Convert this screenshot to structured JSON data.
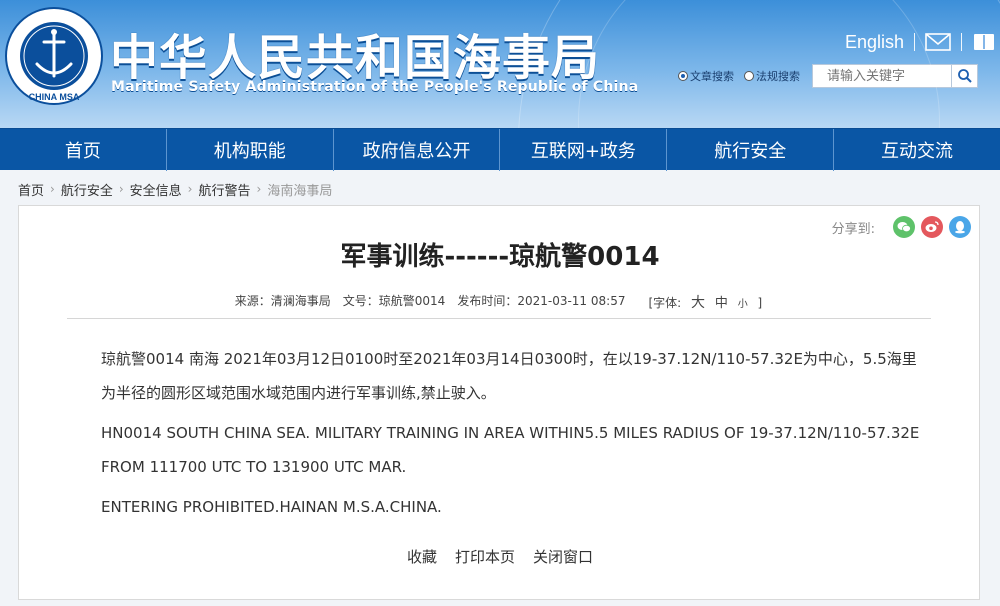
{
  "header": {
    "title_cn": "中华人民共和国海事局",
    "title_en": "Maritime Safety Administration of the People's Republic of China",
    "logo_text_top": "中华人民共和国海事局",
    "logo_text_bottom": "CHINA MSA",
    "lang_label": "English",
    "search": {
      "options": [
        "文章搜索",
        "法规搜索"
      ],
      "selected": "文章搜索",
      "placeholder": "请输入关键字"
    }
  },
  "nav": {
    "items": [
      "首页",
      "机构职能",
      "政府信息公开",
      "互联网+政务",
      "航行安全",
      "互动交流"
    ]
  },
  "breadcrumb": [
    "首页",
    "航行安全",
    "安全信息",
    "航行警告",
    "海南海事局"
  ],
  "article": {
    "share_label": "分享到:",
    "title": "军事训练------琼航警0014",
    "source": "来源：清澜海事局",
    "doc_no": "文号：琼航警0014",
    "publish_time": "发布时间：2021-03-11 08:57",
    "font_label": "[字体:",
    "font_large": "大",
    "font_mid": "中",
    "font_small": "小",
    "font_close": "]",
    "paragraphs": [
      "琼航警0014  南海 2021年03月12日0100时至2021年03月14日0300时，在以19-37.12N/110-57.32E为中心，5.5海里为半径的圆形区域范围水域范围内进行军事训练,禁止驶入。",
      "HN0014    SOUTH CHINA SEA. MILITARY TRAINING IN AREA WITHIN5.5 MILES RADIUS OF 19-37.12N/110-57.32E FROM 111700 UTC TO 131900 UTC MAR.",
      "ENTERING PROHIBITED.HAINAN M.S.A.CHINA."
    ],
    "actions": [
      "收藏",
      "打印本页",
      "关闭窗口"
    ]
  },
  "colors": {
    "nav_bg": "#0a56a5",
    "header_top": "#3c8fd9",
    "wechat": "#5ec26a",
    "weibo": "#e4585d",
    "qq": "#4aa6e8"
  }
}
